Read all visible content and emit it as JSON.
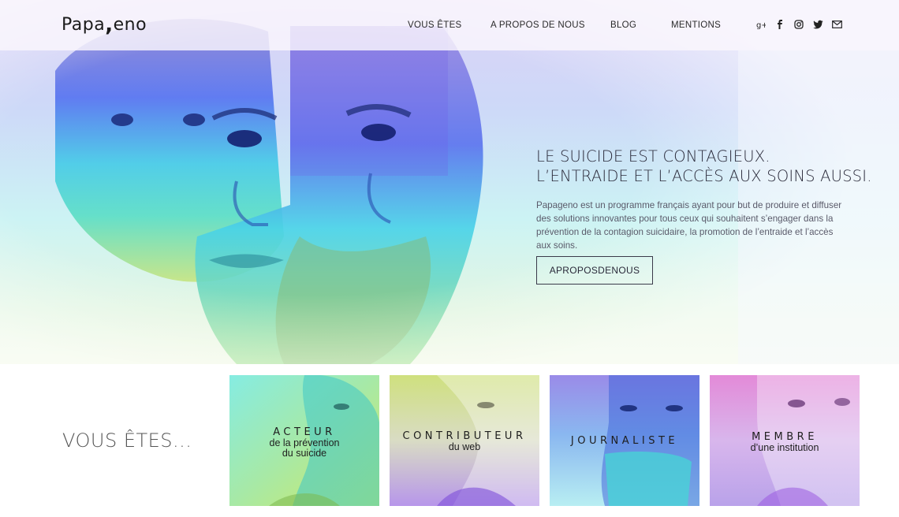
{
  "header": {
    "logo_left": "Papa",
    "logo_comma": ",",
    "logo_right": "eno",
    "nav": [
      "VOUS ÊTES",
      "A PROPOS DE NOUS",
      "BLOG",
      "MENTIONS"
    ],
    "social_icons": [
      "google-plus-icon",
      "facebook-icon",
      "instagram-icon",
      "twitter-icon",
      "mail-icon"
    ]
  },
  "hero": {
    "title_line1": "LE SUICIDE EST CONTAGIEUX.",
    "title_line2": "L’ENTRAIDE ET L’ACCÈS AUX SOINS AUSSI.",
    "text": "Papageno est un programme français ayant pour but de produire et diffuser des solutions innovantes pour tous ceux qui souhaitent s’engager dans la prévention de la contagion suicidaire, la promotion de l’entraide et l’accès aux soins.",
    "button": "APROPOSDENOUS"
  },
  "audience": {
    "heading": "VOUS ÊTES...",
    "cards": [
      {
        "title": "ACTEUR",
        "sub1": "de la prévention",
        "sub2": "du suicide"
      },
      {
        "title": "CONTRIBUTEUR",
        "sub1": "du web",
        "sub2": ""
      },
      {
        "title": "JOURNALISTE",
        "sub1": "",
        "sub2": ""
      },
      {
        "title": "MEMBRE",
        "sub1": "d’une institution",
        "sub2": ""
      }
    ]
  },
  "colors": {
    "violet": "#7b5ef0",
    "blue": "#3d6ff0",
    "cyan": "#45e0e0",
    "lime": "#b8e04a",
    "magenta": "#d84fd8"
  }
}
